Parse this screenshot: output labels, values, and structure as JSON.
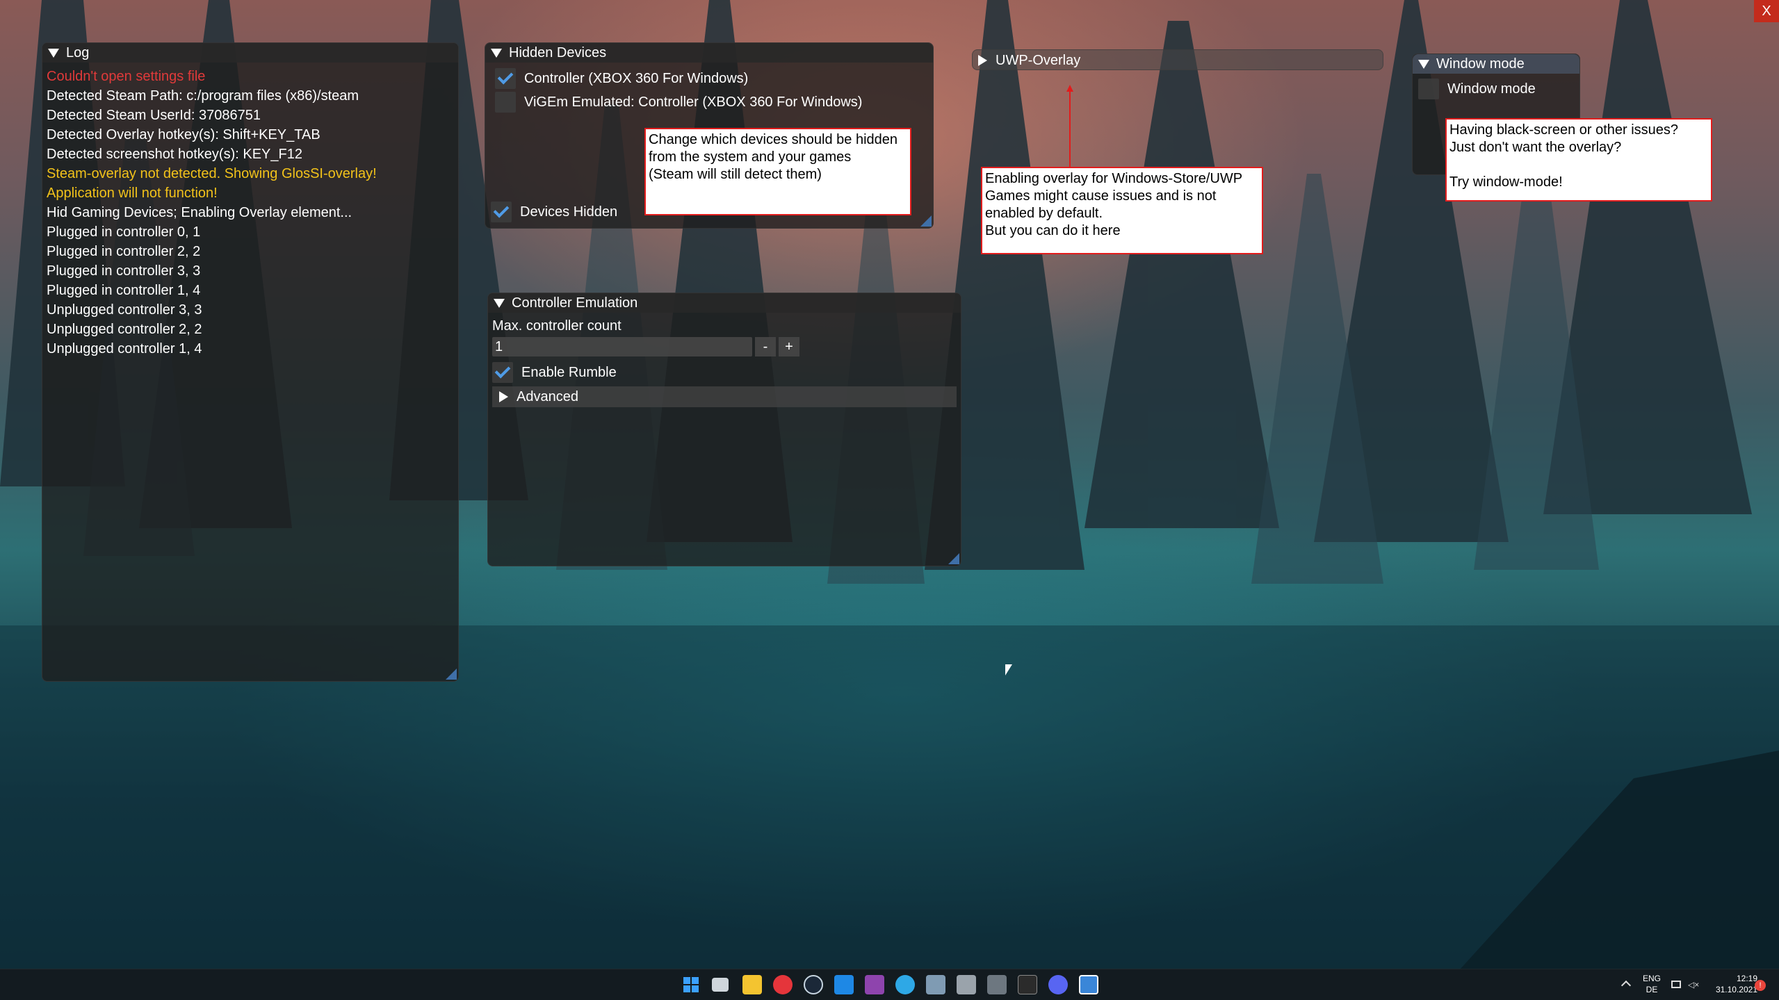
{
  "close_button": {
    "label": "X"
  },
  "log": {
    "title": "Log",
    "lines": [
      {
        "text": "Couldn't open settings file",
        "color": "#e03a3a"
      },
      {
        "text": "Detected Steam Path: c:/program files (x86)/steam",
        "color": "#ffffff"
      },
      {
        "text": "Detected Steam UserId: 37086751",
        "color": "#ffffff"
      },
      {
        "text": "Detected Overlay hotkey(s): Shift+KEY_TAB",
        "color": "#ffffff"
      },
      {
        "text": "Detected screenshot hotkey(s): KEY_F12",
        "color": "#ffffff"
      },
      {
        "text": "Steam-overlay not detected. Showing GlosSI-overlay!",
        "color": "#f2c21a"
      },
      {
        "text": "Application will not function!",
        "color": "#f2c21a"
      },
      {
        "text": "Hid Gaming Devices; Enabling Overlay element...",
        "color": "#ffffff"
      },
      {
        "text": "Plugged in controller 0, 1",
        "color": "#ffffff"
      },
      {
        "text": "Plugged in controller 2, 2",
        "color": "#ffffff"
      },
      {
        "text": "Plugged in controller 3, 3",
        "color": "#ffffff"
      },
      {
        "text": "Plugged in controller 1, 4",
        "color": "#ffffff"
      },
      {
        "text": "Unplugged controller 3, 3",
        "color": "#ffffff"
      },
      {
        "text": "Unplugged controller 2, 2",
        "color": "#ffffff"
      },
      {
        "text": "Unplugged controller 1, 4",
        "color": "#ffffff"
      }
    ]
  },
  "hidden_devices": {
    "title": "Hidden Devices",
    "devices": [
      {
        "label": "Controller (XBOX 360 For Windows)",
        "checked": true
      },
      {
        "label": "ViGEm Emulated: Controller (XBOX 360 For Windows)",
        "checked": false
      }
    ],
    "devices_hidden_label": "Devices Hidden",
    "devices_hidden_checked": true,
    "note": "Change which devices should be hidden from the system and your games\n(Steam will still detect them)"
  },
  "uwp_overlay": {
    "title": "UWP-Overlay",
    "note": "Enabling overlay for Windows-Store/UWP Games might cause issues and is not enabled by default.\nBut you can do it here"
  },
  "window_mode": {
    "title": "Window mode",
    "checkbox_label": "Window mode",
    "checked": false,
    "note": "Having black-screen or other issues?\nJust don't want the overlay?\n\nTry window-mode!"
  },
  "controller_emulation": {
    "title": "Controller Emulation",
    "max_count_label": "Max. controller count",
    "max_count_value": "1",
    "minus_label": "-",
    "plus_label": "+",
    "rumble_label": "Enable Rumble",
    "rumble_checked": true,
    "advanced_label": "Advanced"
  },
  "taskbar": {
    "icons": [
      "windows-start-icon",
      "task-view-icon",
      "file-explorer-icon",
      "vivaldi-icon",
      "steam-icon",
      "vscode-icon",
      "visual-studio-icon",
      "info-app-icon",
      "photos-icon",
      "app-icon",
      "app-icon-2",
      "terminal-icon",
      "discord-icon",
      "glossi-icon"
    ],
    "lang_top": "ENG",
    "lang_bottom": "DE",
    "time": "12:19",
    "date": "31.10.2021"
  }
}
